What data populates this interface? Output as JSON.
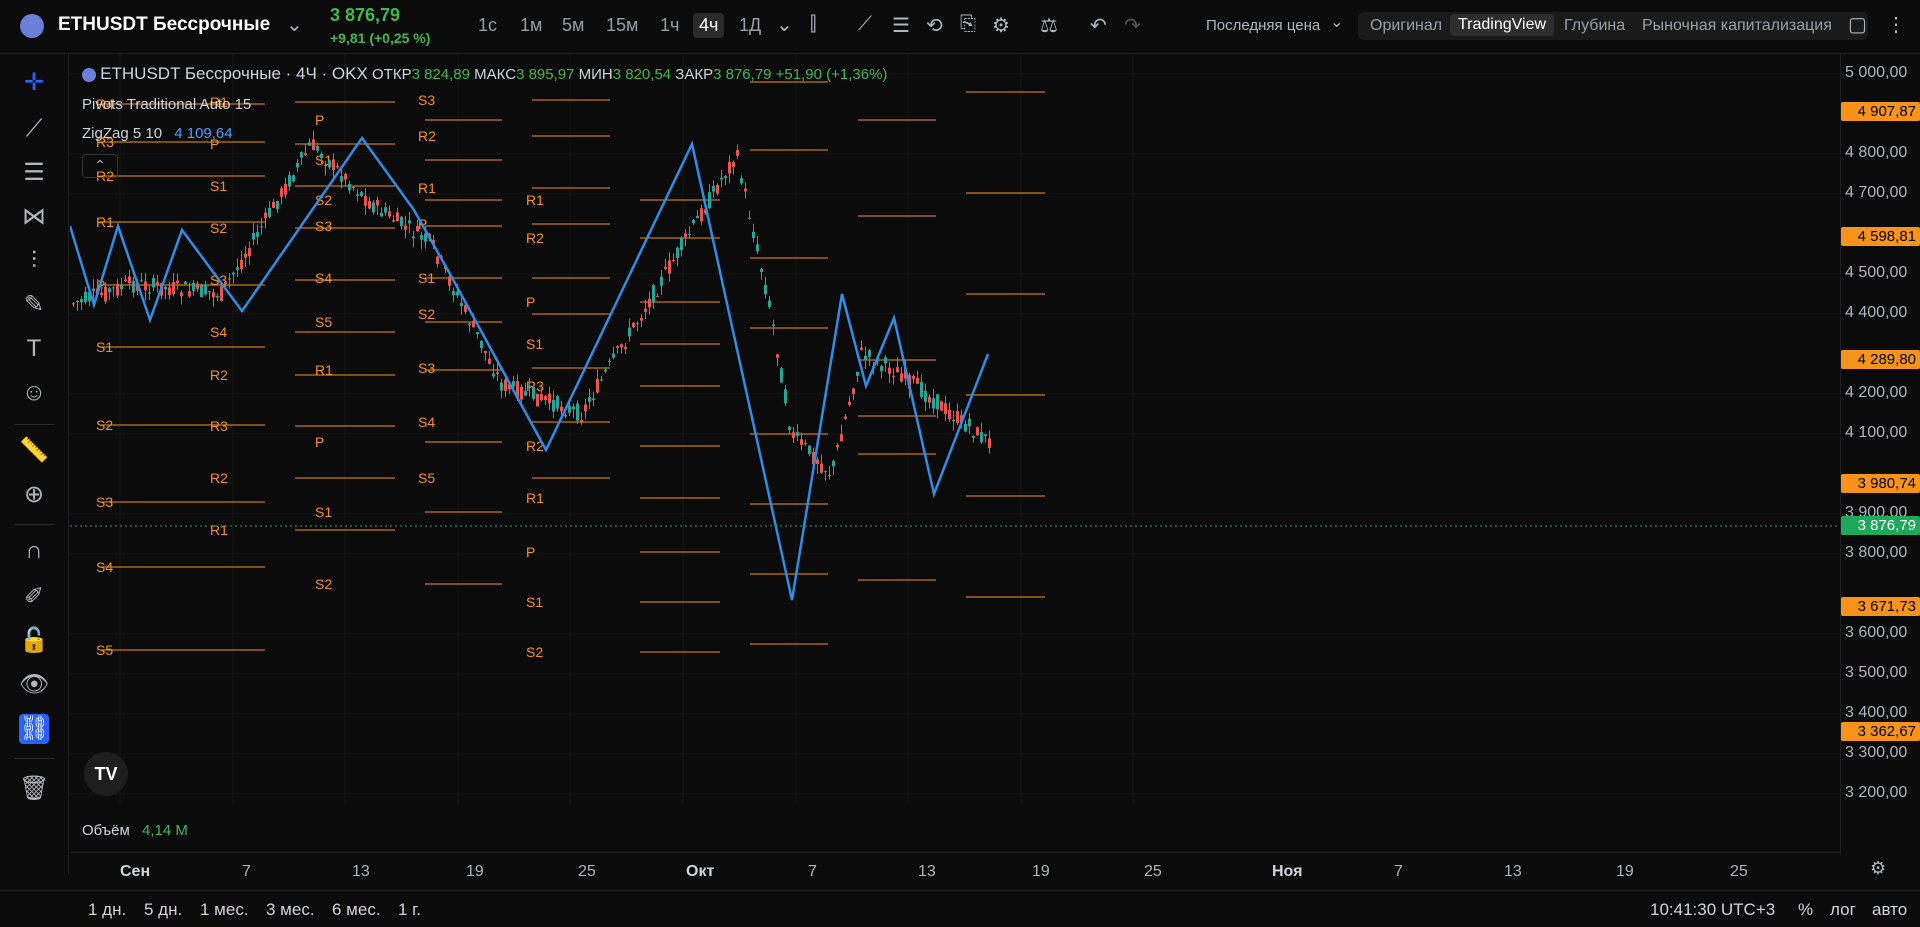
{
  "header": {
    "symbol": "ETHUSDT Бессрочные",
    "price": "3 876,79",
    "change": "+9,81 (+0,25 %)",
    "timeframes": [
      "1с",
      "1м",
      "5м",
      "15м",
      "1ч",
      "4ч",
      "1Д"
    ],
    "active_timeframe": "4ч",
    "price_type": "Последняя цена",
    "views": [
      "Оригинал",
      "TradingView",
      "Глубина",
      "Рыночная капитализация"
    ],
    "active_view": "TradingView"
  },
  "legend": {
    "title": "ETHUSDT Бессрочные · 4Ч · OKX",
    "open_label": "ОТКР",
    "open": "3 824,89",
    "high_label": "МАКС",
    "high": "3 895,97",
    "low_label": "МИН",
    "low": "3 820,54",
    "close_label": "ЗАКР",
    "close": "3 876,79",
    "delta": "+51,90 (+1,36%)",
    "pivots": "Pivots Traditional Auto 15",
    "zigzag": "ZigZag 5 10",
    "zigzag_value": "4 109,64",
    "volume_label": "Объём",
    "volume_value": "4,14 M"
  },
  "price_axis": {
    "labels": [
      "5 000,00",
      "4 800,00",
      "4 700,00",
      "4 500,00",
      "4 400,00",
      "4 200,00",
      "4 100,00",
      "3 900,00",
      "3 800,00",
      "3 600,00",
      "3 500,00",
      "3 400,00",
      "3 300,00",
      "3 200,00"
    ],
    "badges": [
      {
        "text": "4 907,87",
        "kind": "orange"
      },
      {
        "text": "4 598,81",
        "kind": "orange"
      },
      {
        "text": "4 289,80",
        "kind": "orange"
      },
      {
        "text": "3 980,74",
        "kind": "orange"
      },
      {
        "text": "3 876,79",
        "kind": "green"
      },
      {
        "text": "3 671,73",
        "kind": "orange"
      },
      {
        "text": "3 362,67",
        "kind": "orange"
      }
    ]
  },
  "time_axis": {
    "labels": [
      "Сен",
      "7",
      "13",
      "19",
      "25",
      "Окт",
      "7",
      "13",
      "19",
      "25",
      "Ноя",
      "7",
      "13",
      "19",
      "25"
    ]
  },
  "pivot_labels": [
    "R2",
    "R4",
    "R3",
    "R2",
    "R1",
    "P",
    "S1",
    "S2",
    "S3",
    "S4",
    "S5",
    "R1",
    "P",
    "S1",
    "S2",
    "S3",
    "S4",
    "R2",
    "R3",
    "R2",
    "R1",
    "P",
    "S1",
    "S2",
    "S3",
    "S4",
    "S5",
    "R1",
    "P",
    "S1",
    "S2",
    "S3",
    "R2",
    "R1",
    "P",
    "S1",
    "S2",
    "S3",
    "S4",
    "S5",
    "R1",
    "R2",
    "P",
    "S1",
    "R3",
    "R2",
    "R1",
    "P",
    "S1",
    "S2"
  ],
  "bottom": {
    "ranges": [
      "1 дн.",
      "5 дн.",
      "1 мес.",
      "3 мес.",
      "6 мес.",
      "1 г."
    ],
    "clock": "10:41:30 UTC+3",
    "percent": "%",
    "log": "лог",
    "auto": "авто"
  },
  "colors": {
    "up": "#26a69a",
    "down": "#ef5350",
    "pivot": "#f7931a",
    "zigzag": "#2f8de4",
    "accent": "#2962ff"
  }
}
